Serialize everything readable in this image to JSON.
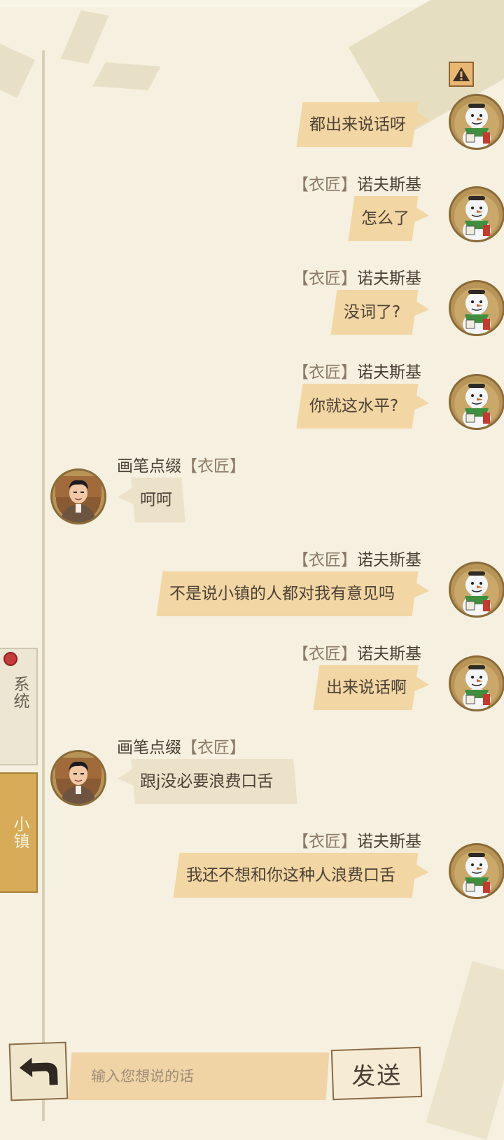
{
  "header": {
    "warning_icon": "warning-icon"
  },
  "sidebar": {
    "tabs": [
      {
        "label": "系统",
        "selected": false
      },
      {
        "label": "小镇",
        "selected": true
      }
    ]
  },
  "messages": [
    {
      "side": "right",
      "role": "",
      "user": "",
      "text": "都出来说话呀",
      "avatar": "snowman-avatar"
    },
    {
      "side": "right",
      "role": "【衣匠】",
      "user": "诺夫斯基",
      "text": "怎么了",
      "avatar": "snowman-avatar"
    },
    {
      "side": "right",
      "role": "【衣匠】",
      "user": "诺夫斯基",
      "text": "没词了?",
      "avatar": "snowman-avatar"
    },
    {
      "side": "right",
      "role": "【衣匠】",
      "user": "诺夫斯基",
      "text": "你就这水平?",
      "avatar": "snowman-avatar"
    },
    {
      "side": "left",
      "role": "【衣匠】",
      "user": "画笔点缀",
      "text": "呵呵",
      "avatar": "man-avatar"
    },
    {
      "side": "right",
      "role": "【衣匠】",
      "user": "诺夫斯基",
      "text": "不是说小镇的人都对我有意见吗",
      "avatar": "snowman-avatar"
    },
    {
      "side": "right",
      "role": "【衣匠】",
      "user": "诺夫斯基",
      "text": "出来说话啊",
      "avatar": "snowman-avatar"
    },
    {
      "side": "left",
      "role": "【衣匠】",
      "user": "画笔点缀",
      "text": "跟j没必要浪费口舌",
      "avatar": "man-avatar"
    },
    {
      "side": "right",
      "role": "【衣匠】",
      "user": "诺夫斯基",
      "text": "我还不想和你这种人浪费口舌",
      "avatar": "snowman-avatar"
    }
  ],
  "input": {
    "placeholder": "输入您想说的话",
    "value": ""
  },
  "buttons": {
    "send_label": "发送",
    "back_icon": "back-arrow-icon"
  },
  "colors": {
    "background": "#f5f0df",
    "bubble_self": "#f2d6a3",
    "bubble_other": "#ebe2c9",
    "tab_active": "#d7ab58"
  }
}
